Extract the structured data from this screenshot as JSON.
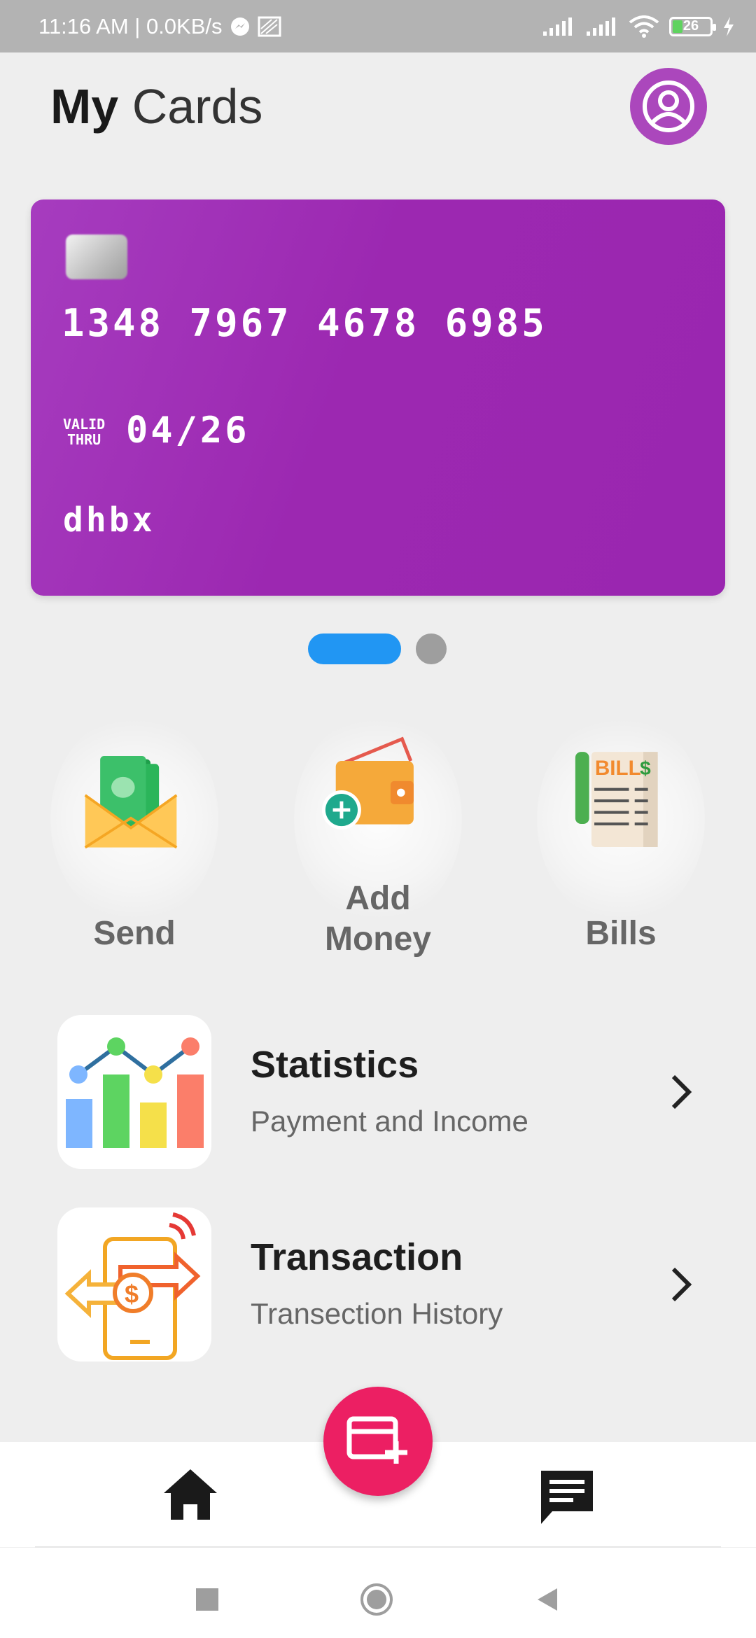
{
  "status_bar": {
    "time_speed": "11:16 AM | 0.0KB/s",
    "battery": "26"
  },
  "header": {
    "title_bold": "My",
    "title_light": "Cards"
  },
  "card": {
    "number": "1348 7967 4678 6985",
    "valid_label_line1": "VALID",
    "valid_label_line2": "THRU",
    "expiry": "04/26",
    "holder": "dhbx",
    "pagination": {
      "current": 1,
      "total": 2
    }
  },
  "actions": {
    "send": "Send",
    "add_money_line1": "Add",
    "add_money_line2": "Money",
    "bills": "Bills",
    "bill_text": "BILL",
    "bill_dollar": "$"
  },
  "list": {
    "statistics": {
      "title": "Statistics",
      "subtitle": "Payment and Income"
    },
    "transaction": {
      "title": "Transaction",
      "subtitle": "Transection History"
    }
  },
  "colors": {
    "card_purple": "#9c27b0",
    "avatar": "#ab47bc",
    "fab": "#ec1f63",
    "active_dot": "#2196f3"
  }
}
